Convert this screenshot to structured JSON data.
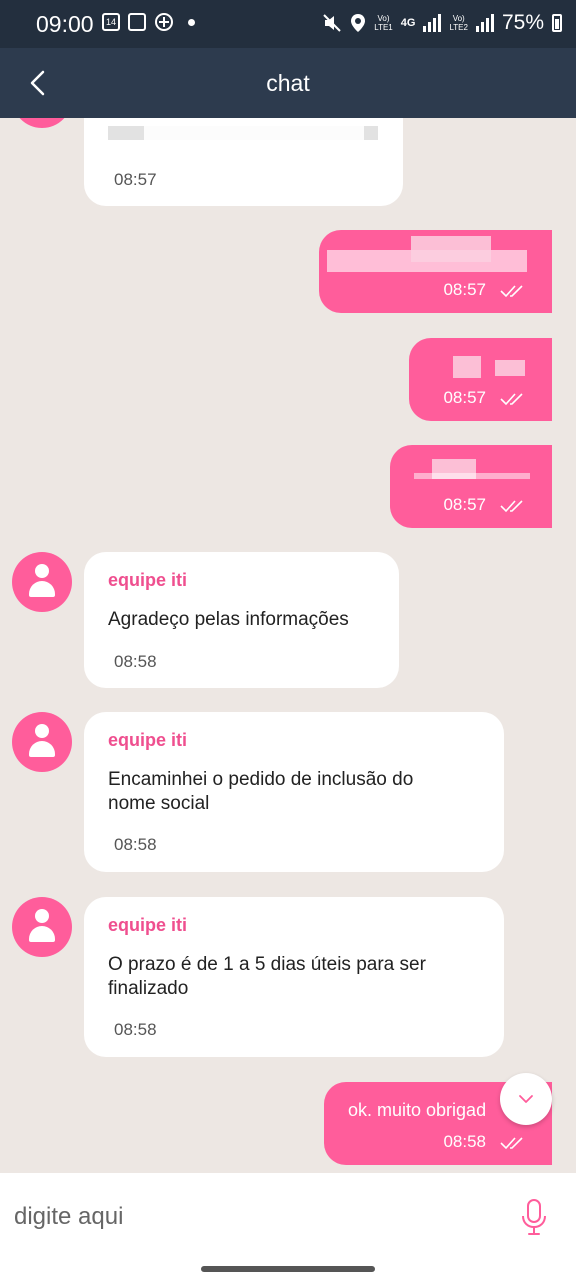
{
  "status_bar": {
    "time": "09:00",
    "left_icons": [
      "calendar-icon",
      "gallery-icon",
      "app-icon",
      "dot-icon"
    ],
    "right_icons": [
      "mute-icon",
      "location-icon",
      "volte-lte1-icon",
      "4g-icon",
      "signal-icon",
      "volte-lte2-icon",
      "signal-icon",
      "battery-icon"
    ],
    "net1_top": "Vo)",
    "net1_bottom": "LTE1",
    "net_4g": "4G",
    "net2_top": "Vo)",
    "net2_bottom": "LTE2",
    "battery": "75%"
  },
  "header": {
    "title": "chat"
  },
  "messages": [
    {
      "direction": "in",
      "sender": "",
      "text": "",
      "time": "08:57"
    },
    {
      "direction": "out",
      "text": "",
      "time": "08:57"
    },
    {
      "direction": "out",
      "text": "",
      "time": "08:57"
    },
    {
      "direction": "out",
      "text": "",
      "time": "08:57"
    },
    {
      "direction": "in",
      "sender": "equipe iti",
      "text": "Agradeço pelas informações",
      "time": "08:58"
    },
    {
      "direction": "in",
      "sender": "equipe iti",
      "text": "Encaminhei o pedido de inclusão do nome social",
      "time": "08:58"
    },
    {
      "direction": "in",
      "sender": "equipe iti",
      "text": "O prazo é de 1 a 5 dias úteis para ser finalizado",
      "time": "08:58"
    },
    {
      "direction": "out",
      "text": "ok. muito obrigad",
      "time": "08:58"
    }
  ],
  "input": {
    "placeholder": "digite aqui"
  },
  "colors": {
    "accent": "#ff5d9b",
    "sender": "#ef4f8f",
    "header": "#2d3b4e",
    "statusbar": "#232f3e",
    "chat_bg": "#ede7e3"
  }
}
